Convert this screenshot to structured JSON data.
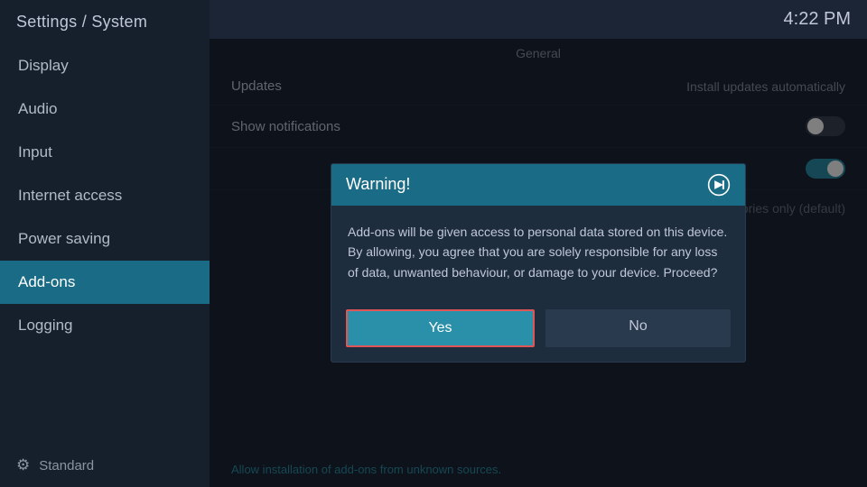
{
  "sidebar": {
    "title": "Settings / System",
    "items": [
      {
        "label": "Display",
        "id": "display",
        "active": false
      },
      {
        "label": "Audio",
        "id": "audio",
        "active": false
      },
      {
        "label": "Input",
        "id": "input",
        "active": false
      },
      {
        "label": "Internet access",
        "id": "internet-access",
        "active": false
      },
      {
        "label": "Power saving",
        "id": "power-saving",
        "active": false
      },
      {
        "label": "Add-ons",
        "id": "add-ons",
        "active": true
      },
      {
        "label": "Logging",
        "id": "logging",
        "active": false
      }
    ],
    "footer_label": "Standard"
  },
  "topbar": {
    "time": "4:22 PM"
  },
  "content": {
    "section_label": "General",
    "rows": [
      {
        "label": "Updates",
        "value": "Install updates automatically",
        "type": "text"
      },
      {
        "label": "Show notifications",
        "value": "",
        "type": "toggle-off"
      },
      {
        "label": "",
        "value": "",
        "type": "toggle-on"
      },
      {
        "label": "",
        "value": "Official repositories only (default)",
        "type": "repo"
      }
    ],
    "unknown_sources_label": "Allow installation of add-ons from unknown sources."
  },
  "modal": {
    "title": "Warning!",
    "body": "Add-ons will be given access to personal data stored on this device. By allowing, you agree that you are solely responsible for any loss of data, unwanted behaviour, or damage to your device. Proceed?",
    "btn_yes": "Yes",
    "btn_no": "No"
  }
}
